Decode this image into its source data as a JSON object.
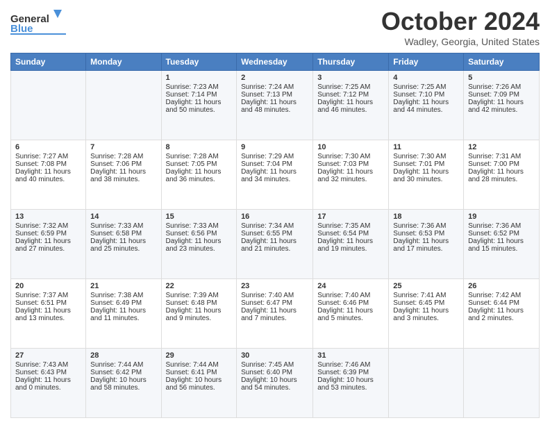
{
  "header": {
    "logo_general": "General",
    "logo_blue": "Blue",
    "month_title": "October 2024",
    "location": "Wadley, Georgia, United States"
  },
  "days_of_week": [
    "Sunday",
    "Monday",
    "Tuesday",
    "Wednesday",
    "Thursday",
    "Friday",
    "Saturday"
  ],
  "weeks": [
    [
      {
        "day": "",
        "sunrise": "",
        "sunset": "",
        "daylight": ""
      },
      {
        "day": "",
        "sunrise": "",
        "sunset": "",
        "daylight": ""
      },
      {
        "day": "1",
        "sunrise": "Sunrise: 7:23 AM",
        "sunset": "Sunset: 7:14 PM",
        "daylight": "Daylight: 11 hours and 50 minutes."
      },
      {
        "day": "2",
        "sunrise": "Sunrise: 7:24 AM",
        "sunset": "Sunset: 7:13 PM",
        "daylight": "Daylight: 11 hours and 48 minutes."
      },
      {
        "day": "3",
        "sunrise": "Sunrise: 7:25 AM",
        "sunset": "Sunset: 7:12 PM",
        "daylight": "Daylight: 11 hours and 46 minutes."
      },
      {
        "day": "4",
        "sunrise": "Sunrise: 7:25 AM",
        "sunset": "Sunset: 7:10 PM",
        "daylight": "Daylight: 11 hours and 44 minutes."
      },
      {
        "day": "5",
        "sunrise": "Sunrise: 7:26 AM",
        "sunset": "Sunset: 7:09 PM",
        "daylight": "Daylight: 11 hours and 42 minutes."
      }
    ],
    [
      {
        "day": "6",
        "sunrise": "Sunrise: 7:27 AM",
        "sunset": "Sunset: 7:08 PM",
        "daylight": "Daylight: 11 hours and 40 minutes."
      },
      {
        "day": "7",
        "sunrise": "Sunrise: 7:28 AM",
        "sunset": "Sunset: 7:06 PM",
        "daylight": "Daylight: 11 hours and 38 minutes."
      },
      {
        "day": "8",
        "sunrise": "Sunrise: 7:28 AM",
        "sunset": "Sunset: 7:05 PM",
        "daylight": "Daylight: 11 hours and 36 minutes."
      },
      {
        "day": "9",
        "sunrise": "Sunrise: 7:29 AM",
        "sunset": "Sunset: 7:04 PM",
        "daylight": "Daylight: 11 hours and 34 minutes."
      },
      {
        "day": "10",
        "sunrise": "Sunrise: 7:30 AM",
        "sunset": "Sunset: 7:03 PM",
        "daylight": "Daylight: 11 hours and 32 minutes."
      },
      {
        "day": "11",
        "sunrise": "Sunrise: 7:30 AM",
        "sunset": "Sunset: 7:01 PM",
        "daylight": "Daylight: 11 hours and 30 minutes."
      },
      {
        "day": "12",
        "sunrise": "Sunrise: 7:31 AM",
        "sunset": "Sunset: 7:00 PM",
        "daylight": "Daylight: 11 hours and 28 minutes."
      }
    ],
    [
      {
        "day": "13",
        "sunrise": "Sunrise: 7:32 AM",
        "sunset": "Sunset: 6:59 PM",
        "daylight": "Daylight: 11 hours and 27 minutes."
      },
      {
        "day": "14",
        "sunrise": "Sunrise: 7:33 AM",
        "sunset": "Sunset: 6:58 PM",
        "daylight": "Daylight: 11 hours and 25 minutes."
      },
      {
        "day": "15",
        "sunrise": "Sunrise: 7:33 AM",
        "sunset": "Sunset: 6:56 PM",
        "daylight": "Daylight: 11 hours and 23 minutes."
      },
      {
        "day": "16",
        "sunrise": "Sunrise: 7:34 AM",
        "sunset": "Sunset: 6:55 PM",
        "daylight": "Daylight: 11 hours and 21 minutes."
      },
      {
        "day": "17",
        "sunrise": "Sunrise: 7:35 AM",
        "sunset": "Sunset: 6:54 PM",
        "daylight": "Daylight: 11 hours and 19 minutes."
      },
      {
        "day": "18",
        "sunrise": "Sunrise: 7:36 AM",
        "sunset": "Sunset: 6:53 PM",
        "daylight": "Daylight: 11 hours and 17 minutes."
      },
      {
        "day": "19",
        "sunrise": "Sunrise: 7:36 AM",
        "sunset": "Sunset: 6:52 PM",
        "daylight": "Daylight: 11 hours and 15 minutes."
      }
    ],
    [
      {
        "day": "20",
        "sunrise": "Sunrise: 7:37 AM",
        "sunset": "Sunset: 6:51 PM",
        "daylight": "Daylight: 11 hours and 13 minutes."
      },
      {
        "day": "21",
        "sunrise": "Sunrise: 7:38 AM",
        "sunset": "Sunset: 6:49 PM",
        "daylight": "Daylight: 11 hours and 11 minutes."
      },
      {
        "day": "22",
        "sunrise": "Sunrise: 7:39 AM",
        "sunset": "Sunset: 6:48 PM",
        "daylight": "Daylight: 11 hours and 9 minutes."
      },
      {
        "day": "23",
        "sunrise": "Sunrise: 7:40 AM",
        "sunset": "Sunset: 6:47 PM",
        "daylight": "Daylight: 11 hours and 7 minutes."
      },
      {
        "day": "24",
        "sunrise": "Sunrise: 7:40 AM",
        "sunset": "Sunset: 6:46 PM",
        "daylight": "Daylight: 11 hours and 5 minutes."
      },
      {
        "day": "25",
        "sunrise": "Sunrise: 7:41 AM",
        "sunset": "Sunset: 6:45 PM",
        "daylight": "Daylight: 11 hours and 3 minutes."
      },
      {
        "day": "26",
        "sunrise": "Sunrise: 7:42 AM",
        "sunset": "Sunset: 6:44 PM",
        "daylight": "Daylight: 11 hours and 2 minutes."
      }
    ],
    [
      {
        "day": "27",
        "sunrise": "Sunrise: 7:43 AM",
        "sunset": "Sunset: 6:43 PM",
        "daylight": "Daylight: 11 hours and 0 minutes."
      },
      {
        "day": "28",
        "sunrise": "Sunrise: 7:44 AM",
        "sunset": "Sunset: 6:42 PM",
        "daylight": "Daylight: 10 hours and 58 minutes."
      },
      {
        "day": "29",
        "sunrise": "Sunrise: 7:44 AM",
        "sunset": "Sunset: 6:41 PM",
        "daylight": "Daylight: 10 hours and 56 minutes."
      },
      {
        "day": "30",
        "sunrise": "Sunrise: 7:45 AM",
        "sunset": "Sunset: 6:40 PM",
        "daylight": "Daylight: 10 hours and 54 minutes."
      },
      {
        "day": "31",
        "sunrise": "Sunrise: 7:46 AM",
        "sunset": "Sunset: 6:39 PM",
        "daylight": "Daylight: 10 hours and 53 minutes."
      },
      {
        "day": "",
        "sunrise": "",
        "sunset": "",
        "daylight": ""
      },
      {
        "day": "",
        "sunrise": "",
        "sunset": "",
        "daylight": ""
      }
    ]
  ]
}
